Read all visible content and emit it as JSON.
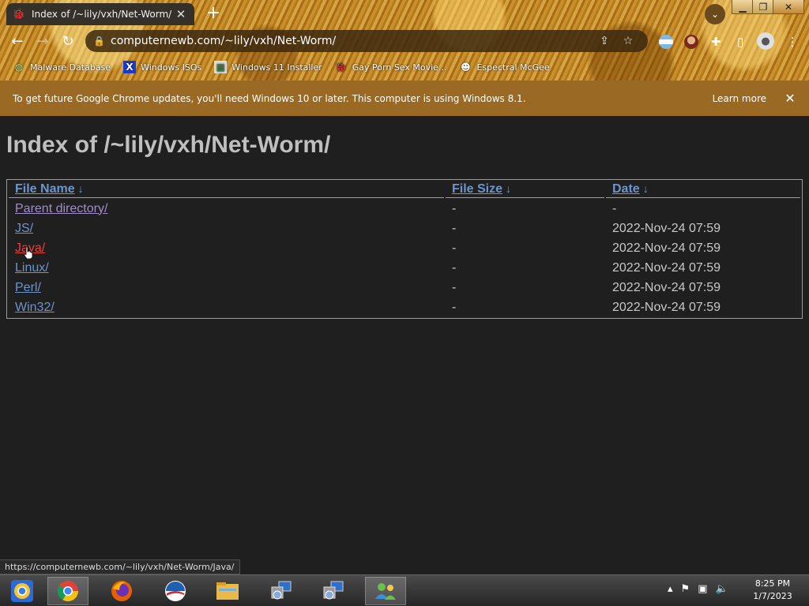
{
  "tab": {
    "title": "Index of /~lily/vxh/Net-Worm/",
    "favicon": "bug-favicon"
  },
  "omnibox": {
    "url": "computernewb.com/~lily/vxh/Net-Worm/"
  },
  "bookmarks": [
    {
      "label": "Malware Database",
      "icon": "earth-icon"
    },
    {
      "label": "Windows ISOs",
      "icon": "x-icon"
    },
    {
      "label": "Windows 11 Installer",
      "icon": "picture-icon"
    },
    {
      "label": "Gay Porn Sex Movie...",
      "icon": "bug-icon"
    },
    {
      "label": "Espectral McGee",
      "icon": "face-icon"
    }
  ],
  "infobar": {
    "message": "To get future Google Chrome updates, you'll need Windows 10 or later. This computer is using Windows 8.1.",
    "learn_more": "Learn more"
  },
  "page": {
    "heading": "Index of /~lily/vxh/Net-Worm/",
    "columns": {
      "name": "File Name",
      "size": "File Size",
      "date": "Date",
      "sort_arrow": "↓"
    },
    "rows": [
      {
        "name": "Parent directory/",
        "size": "-",
        "date": "-"
      },
      {
        "name": "JS/",
        "size": "-",
        "date": "2022-Nov-24 07:59"
      },
      {
        "name": "Java/",
        "size": "-",
        "date": "2022-Nov-24 07:59"
      },
      {
        "name": "Linux/",
        "size": "-",
        "date": "2022-Nov-24 07:59"
      },
      {
        "name": "Perl/",
        "size": "-",
        "date": "2022-Nov-24 07:59"
      },
      {
        "name": "Win32/",
        "size": "-",
        "date": "2022-Nov-24 07:59"
      }
    ]
  },
  "status_url": "https://computernewb.com/~lily/vxh/Net-Worm/Java/",
  "taskbar": {
    "apps": [
      "chrome-canary-icon",
      "chrome-icon",
      "firefox-icon",
      "obama-icon",
      "file-explorer-icon",
      "network-setup-icon",
      "network-setup-icon",
      "users-icon"
    ],
    "time": "8:25 PM",
    "date": "1/7/2023"
  },
  "colors": {
    "page_bg": "#1f1f1f",
    "link": "#6b95cf",
    "visited": "#a38ccd",
    "hover": "#e8403b",
    "infobar": "#9a6a25"
  }
}
